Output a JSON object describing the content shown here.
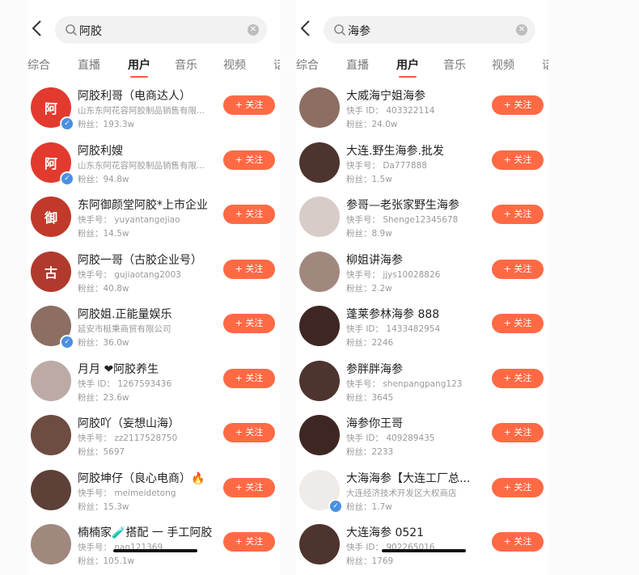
{
  "left": {
    "search_query": "阿胶",
    "tabs": [
      "综合",
      "直播",
      "用户",
      "音乐",
      "视频",
      "话"
    ],
    "active_tab": 2,
    "users": [
      {
        "name": "阿胶利哥（电商达人）",
        "sub": "山东东阿花容阿胶制品销售有限...",
        "fans": "粉丝：193.3w",
        "follow": "+ 关注",
        "avatar_color": "#e23a2e",
        "avatar_text": "阿",
        "verified": true
      },
      {
        "name": "阿胶利嫂",
        "sub": "山东东阿花容阿胶制品销售有限...",
        "fans": "粉丝：94.8w",
        "follow": "+ 关注",
        "avatar_color": "#e23a2e",
        "avatar_text": "阿",
        "verified": true
      },
      {
        "name": "东阿御颜堂阿胶*上市企业",
        "sub": "快手号： yuyantangejiao",
        "fans": "粉丝：14.5w",
        "follow": "+ 关注",
        "avatar_color": "#c0392b",
        "avatar_text": "御",
        "verified": false
      },
      {
        "name": "阿胶一哥（古胶企业号）",
        "sub": "快手号： gujiaotang2003",
        "fans": "粉丝：40.8w",
        "follow": "+ 关注",
        "avatar_color": "#b03a2e",
        "avatar_text": "古",
        "verified": false
      },
      {
        "name": "阿胶姐.正能量娱乐",
        "sub": "延安市梃秉商贸有限公司",
        "fans": "粉丝：36.0w",
        "follow": "+ 关注",
        "avatar_color": "#8d6e63",
        "avatar_text": "",
        "verified": true
      },
      {
        "name": "月月 ❤阿胶养生",
        "sub": "快手 ID： 1267593436",
        "fans": "粉丝：23.6w",
        "follow": "+ 关注",
        "avatar_color": "#bcaaa4",
        "avatar_text": "",
        "verified": false
      },
      {
        "name": "阿胶吖（妄想山海）",
        "sub": "快手号： zz2117528750",
        "fans": "粉丝：5697",
        "follow": "+ 关注",
        "avatar_color": "#6d4c41",
        "avatar_text": "",
        "verified": false
      },
      {
        "name": "阿胶坤仔（良心电商）🔥",
        "sub": "快手号： meimeidetong",
        "fans": "粉丝：15.3w",
        "follow": "+ 关注",
        "avatar_color": "#5d4037",
        "avatar_text": "",
        "verified": false
      },
      {
        "name": "楠楠家🧪搭配 一 手工阿胶",
        "sub": "快手号： nan121369",
        "fans": "粉丝：105.1w",
        "follow": "+ 关注",
        "avatar_color": "#a1887f",
        "avatar_text": "",
        "verified": false
      }
    ]
  },
  "right": {
    "search_query": "海参",
    "tabs": [
      "综合",
      "直播",
      "用户",
      "音乐",
      "视频",
      "话"
    ],
    "active_tab": 2,
    "users": [
      {
        "name": "大威海宁姐海参",
        "sub": "快手 ID： 403322114",
        "fans": "粉丝：24.0w",
        "follow": "+ 关注",
        "avatar_color": "#8d6e63",
        "avatar_text": "",
        "verified": false
      },
      {
        "name": "大连.野生海参.批发",
        "sub": "快手号： Da777888",
        "fans": "粉丝：1.5w",
        "follow": "+ 关注",
        "avatar_color": "#4e342e",
        "avatar_text": "",
        "verified": false
      },
      {
        "name": "参哥—老张家野生海参",
        "sub": "快手号： Shenge12345678",
        "fans": "粉丝：8.9w",
        "follow": "+ 关注",
        "avatar_color": "#d7ccc8",
        "avatar_text": "",
        "verified": false
      },
      {
        "name": "柳姐讲海参",
        "sub": "快手号： jjys10028826",
        "fans": "粉丝：2.2w",
        "follow": "+ 关注",
        "avatar_color": "#a1887f",
        "avatar_text": "",
        "verified": false
      },
      {
        "name": "蓬莱参林海参 888",
        "sub": "快手 ID： 1433482954",
        "fans": "粉丝：2246",
        "follow": "+ 关注",
        "avatar_color": "#3e2723",
        "avatar_text": "",
        "verified": false
      },
      {
        "name": "参胖胖海参",
        "sub": "快手号： shenpangpang123",
        "fans": "粉丝：3645",
        "follow": "+ 关注",
        "avatar_color": "#4e342e",
        "avatar_text": "",
        "verified": false
      },
      {
        "name": "海参你王哥",
        "sub": "快手 ID： 409289435",
        "fans": "粉丝：2233",
        "follow": "+ 关注",
        "avatar_color": "#3e2723",
        "avatar_text": "",
        "verified": false
      },
      {
        "name": "大海海参【大连工厂总...",
        "sub": "大连经济技术开发区大权商店",
        "fans": "粉丝：1.7w",
        "follow": "+ 关注",
        "avatar_color": "#efebe9",
        "avatar_text": "",
        "verified": true
      },
      {
        "name": "大连海参 0521",
        "sub": "快手 ID： 902265016",
        "fans": "粉丝：1769",
        "follow": "+ 关注",
        "avatar_color": "#4e342e",
        "avatar_text": "",
        "verified": false
      }
    ]
  }
}
